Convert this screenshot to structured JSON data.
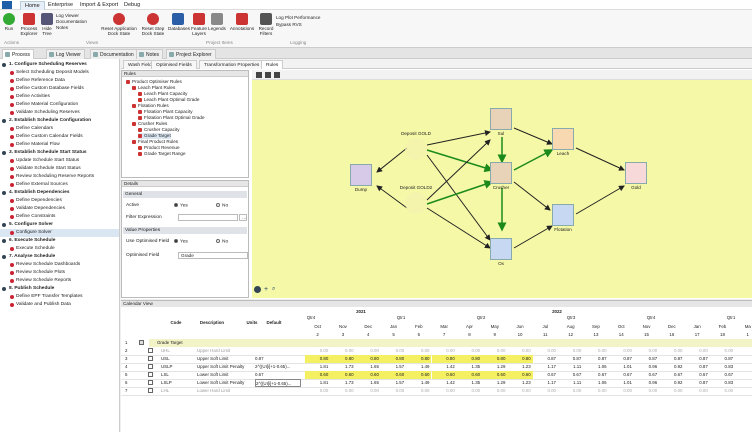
{
  "menubar": {
    "items": [
      "Home",
      "Enterprise",
      "Import & Export",
      "Debug"
    ]
  },
  "ribbon": {
    "buttons": [
      "Run",
      "Process Explorer",
      "Hide Tree",
      "Reset Application Dock State",
      "Reset Step Dock State",
      "Databases",
      "Feature Layers",
      "Legends",
      "Annotations",
      "Record Filters"
    ],
    "small": [
      "Log Viewer",
      "Documentation",
      "Notes",
      "Log Plot Performance",
      "Bypass RVS"
    ],
    "groups": [
      "Actions",
      "Views",
      "Project Items",
      "Logging"
    ]
  },
  "doctabs": [
    "Process",
    "Log Viewer",
    "Documentation",
    "Notes",
    "Project Explorer"
  ],
  "sidebar": {
    "items": [
      {
        "text": "1. Configure Scheduling Reserves",
        "step": true
      },
      {
        "text": "Select Scheduling Deposit Models"
      },
      {
        "text": "Define Reference Data"
      },
      {
        "text": "Define Custom Database Fields"
      },
      {
        "text": "Define Activities"
      },
      {
        "text": "Define Material Configuration"
      },
      {
        "text": "Validate Scheduling Reserves"
      },
      {
        "text": "2. Establish Schedule Configuration",
        "step": true
      },
      {
        "text": "Define Calendars"
      },
      {
        "text": "Define Custom Calendar Fields"
      },
      {
        "text": "Define Material Flow"
      },
      {
        "text": "3. Establish Schedule Start Status",
        "step": true
      },
      {
        "text": "Update Schedule Start Status"
      },
      {
        "text": "Validate Schedule Start Status"
      },
      {
        "text": "Review Scheduling Reserve Reports"
      },
      {
        "text": "Define External Sources"
      },
      {
        "text": "4. Establish Dependencies",
        "step": true
      },
      {
        "text": "Define Dependencies"
      },
      {
        "text": "Validate Dependencies"
      },
      {
        "text": "Define Constraints"
      },
      {
        "text": "5. Configure Solver",
        "step": true
      },
      {
        "text": "Configure Solver",
        "sel": true
      },
      {
        "text": "6. Execute Schedule",
        "step": true
      },
      {
        "text": "Execute Schedule"
      },
      {
        "text": "7. Analyse Schedule",
        "step": true
      },
      {
        "text": "Review Schedule Dashboards"
      },
      {
        "text": "Review Schedule Plots"
      },
      {
        "text": "Review Schedule Reports"
      },
      {
        "text": "8. Publish Schedule",
        "step": true
      },
      {
        "text": "Define EPF Transfer Templates"
      },
      {
        "text": "Validate and Publish Data"
      }
    ]
  },
  "subtabs": [
    "Wash Fields",
    "Optimised Fields",
    "Transformation Properties",
    "Rules"
  ],
  "rules": {
    "title": "Rules",
    "tree": [
      {
        "text": "Product Optimiser Rules",
        "lvl": 0
      },
      {
        "text": "Leach Plant Rules",
        "lvl": 1
      },
      {
        "text": "Leach Plant Capacity",
        "lvl": 2
      },
      {
        "text": "Leach Plant Optimal Grade",
        "lvl": 2
      },
      {
        "text": "Flotation Rules",
        "lvl": 1
      },
      {
        "text": "Flotation Plant Capacity",
        "lvl": 2
      },
      {
        "text": "Flotation Plant Optimal Grade",
        "lvl": 2
      },
      {
        "text": "Crusher Rules",
        "lvl": 1
      },
      {
        "text": "Crusher Capacity",
        "lvl": 2
      },
      {
        "text": "Grade Target",
        "lvl": 2
      },
      {
        "text": "Final Product Rules",
        "lvl": 1
      },
      {
        "text": "Product Revenue",
        "lvl": 2
      },
      {
        "text": "Grade Target Range",
        "lvl": 2
      }
    ]
  },
  "details": {
    "title": "Details",
    "general": "General",
    "active_label": "Active",
    "yes": "Yes",
    "no": "No",
    "filter_label": "Filter Expression",
    "value_props": "Value Properties",
    "use_opt_label": "Use Optimised Field",
    "opt_field_label": "Optimised Field",
    "opt_field_value": "Grade"
  },
  "diagram": {
    "nodes": [
      {
        "name": "Dump",
        "label": "Dump",
        "color": "#d7c9e8"
      },
      {
        "name": "Deposit-GOLD",
        "label": "Deposit GOLD",
        "color": "#f4f2b0"
      },
      {
        "name": "Deposit-GOLD2",
        "label": "Deposit GOLD2",
        "color": "#f4f2b0"
      },
      {
        "name": "Sul",
        "label": "Sul",
        "color": "#e8d3b8"
      },
      {
        "name": "Crusher",
        "label": "Crusher",
        "color": "#e8d3b8"
      },
      {
        "name": "Ox",
        "label": "Ox",
        "color": "#c7d8f2"
      },
      {
        "name": "Leach",
        "label": "Leach",
        "color": "#f7d8b0"
      },
      {
        "name": "Flotation",
        "label": "Flotation",
        "color": "#c7d8f2"
      },
      {
        "name": "Gold",
        "label": "Gold",
        "color": "#f8d9d9"
      }
    ]
  },
  "calendar": {
    "title": "Calendar View",
    "cols": [
      "Code",
      "Description",
      "Units",
      "Default"
    ],
    "years": [
      "2021",
      "2022"
    ],
    "quarters": [
      "Qtr4",
      "Qtr1",
      "Qtr2",
      "Qtr3",
      "Qtr4",
      "Qtr1"
    ],
    "months": [
      "Oct",
      "Nov",
      "Dec",
      "Jan",
      "Feb",
      "Mar",
      "Apr",
      "May",
      "Jun",
      "Jul",
      "Aug",
      "Sep",
      "Oct",
      "Nov",
      "Dec",
      "Jan",
      "Feb",
      "Ma"
    ],
    "periods": [
      "2",
      "3",
      "4",
      "5",
      "6",
      "7",
      "8",
      "9",
      "10",
      "11",
      "12",
      "13",
      "14",
      "15",
      "16",
      "17",
      "18",
      "1"
    ],
    "group": "Grade Target",
    "rows": [
      {
        "n": "1",
        "code": "",
        "desc": "",
        "units": "",
        "def": "",
        "vals": []
      },
      {
        "n": "2",
        "code": "UHL",
        "desc": "Upper Hard Limit",
        "units": "",
        "def": "",
        "vals": [
          "0.00",
          "0.00",
          "0.00",
          "0.00",
          "0.00",
          "0.00",
          "0.00",
          "0.00",
          "0.00",
          "0.00",
          "0.00",
          "0.00",
          "0.00",
          "0.00",
          "0.00",
          "0.00",
          "0.00",
          "0.0"
        ]
      },
      {
        "n": "3",
        "code": "USL",
        "desc": "Upper Soft Limit",
        "units": "",
        "def": "0.87",
        "vals": [
          "0.80",
          "0.80",
          "0.80",
          "0.80",
          "0.80",
          "0.80",
          "0.80",
          "0.80",
          "0.80",
          "0.87",
          "0.87",
          "0.87",
          "0.87",
          "0.87",
          "0.87",
          "0.87",
          "0.87",
          "0.8"
        ]
      },
      {
        "n": "4",
        "code": "USLP",
        "desc": "Upper Soft Limit Penalty",
        "units": "",
        "def": "2^((UI[i]+1-0.65)...",
        "vals": [
          "1.81",
          "1.73",
          "1.65",
          "1.57",
          "1.49",
          "1.42",
          "1.35",
          "1.29",
          "1.23",
          "1.17",
          "1.11",
          "1.06",
          "1.01",
          "0.96",
          "0.92",
          "0.87",
          "0.83",
          "0.7"
        ]
      },
      {
        "n": "5",
        "code": "LSL",
        "desc": "Lower Soft Limit",
        "units": "",
        "def": "0.67",
        "vals": [
          "0.60",
          "0.60",
          "0.60",
          "0.60",
          "0.60",
          "0.60",
          "0.60",
          "0.60",
          "0.60",
          "0.67",
          "0.67",
          "0.67",
          "0.67",
          "0.67",
          "0.67",
          "0.67",
          "0.67",
          "0.6"
        ]
      },
      {
        "n": "6",
        "code": "LSLP",
        "desc": "Lower Soft Limit Penalty",
        "units": "",
        "def": "2^((UI[i]+1-0.65)...",
        "vals": [
          "1.81",
          "1.73",
          "1.65",
          "1.57",
          "1.49",
          "1.42",
          "1.35",
          "1.29",
          "1.23",
          "1.17",
          "1.11",
          "1.06",
          "1.01",
          "0.96",
          "0.92",
          "0.87",
          "0.83",
          "0.7"
        ]
      },
      {
        "n": "7",
        "code": "LHL",
        "desc": "Lower Hard Limit",
        "units": "",
        "def": "",
        "vals": [
          "0.00",
          "0.00",
          "0.00",
          "0.00",
          "0.00",
          "0.00",
          "0.00",
          "0.00",
          "0.00",
          "0.00",
          "0.00",
          "0.00",
          "0.00",
          "0.00",
          "0.00",
          "0.00",
          "0.00",
          "0.0"
        ]
      }
    ]
  }
}
